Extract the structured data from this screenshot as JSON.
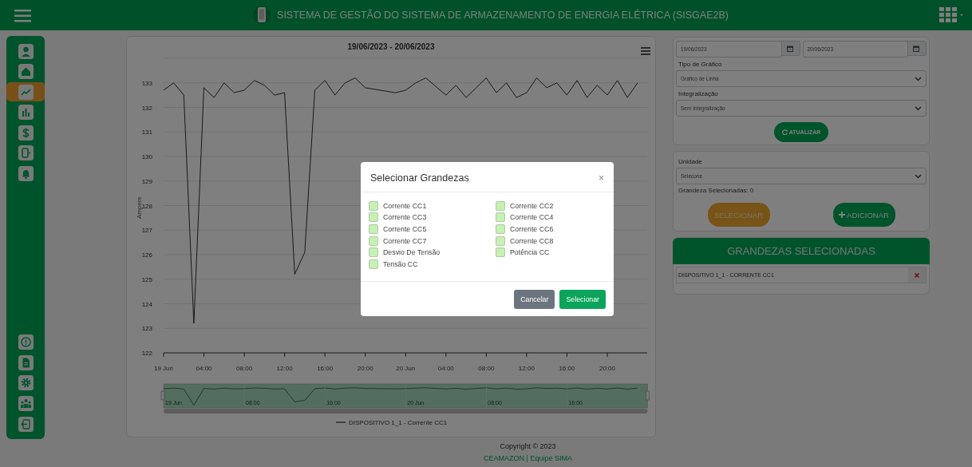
{
  "header": {
    "title": "SISTEMA DE GESTÃO DO SISTEMA DE ARMAZENAMENTO DE ENERGIA ELÉTRICA (SISGAE2B)"
  },
  "sidebar": {
    "top_items": [
      {
        "selected": false
      },
      {
        "selected": false
      },
      {
        "selected": true
      },
      {
        "selected": false
      },
      {
        "selected": false
      },
      {
        "selected": false
      },
      {
        "selected": false
      }
    ],
    "bottom_items": [
      {
        "selected": false
      },
      {
        "selected": false
      },
      {
        "selected": false
      },
      {
        "selected": false
      },
      {
        "selected": false
      }
    ]
  },
  "chart": {
    "navigator_labels": [
      "19 Jun",
      "08:00",
      "16:00",
      "20 Jun",
      "08:00",
      "16:00"
    ],
    "chart_data": {
      "type": "line",
      "title": "19/06/2023 - 20/06/2023",
      "ylabel": "Ampere",
      "x": [
        "2023-06-19T00:00",
        "2023-06-19T01:00",
        "2023-06-19T02:00",
        "2023-06-19T03:00",
        "2023-06-19T04:00",
        "2023-06-19T05:00",
        "2023-06-19T06:00",
        "2023-06-19T07:00",
        "2023-06-19T08:00",
        "2023-06-19T09:00",
        "2023-06-19T10:00",
        "2023-06-19T11:00",
        "2023-06-19T12:00",
        "2023-06-19T13:00",
        "2023-06-19T14:00",
        "2023-06-19T15:00",
        "2023-06-19T16:00",
        "2023-06-19T17:00",
        "2023-06-19T18:00",
        "2023-06-19T19:00",
        "2023-06-19T20:00",
        "2023-06-19T23:00",
        "2023-06-20T00:00",
        "2023-06-20T01:00",
        "2023-06-20T02:00",
        "2023-06-20T04:00",
        "2023-06-20T05:00",
        "2023-06-20T06:00",
        "2023-06-20T07:00",
        "2023-06-20T08:00",
        "2023-06-20T09:00",
        "2023-06-20T10:00",
        "2023-06-20T11:00",
        "2023-06-20T12:00",
        "2023-06-20T13:00",
        "2023-06-20T14:00",
        "2023-06-20T15:00",
        "2023-06-20T16:00",
        "2023-06-20T17:00",
        "2023-06-20T18:00",
        "2023-06-20T19:00",
        "2023-06-20T20:00",
        "2023-06-20T21:00",
        "2023-06-20T22:00",
        "2023-06-20T23:00"
      ],
      "series": [
        {
          "name": "DISPOSITIVO 1_1 - Corrente CC1",
          "color": "#333333",
          "values": [
            132.7,
            133.0,
            132.5,
            123.2,
            132.8,
            132.4,
            133.0,
            132.6,
            132.7,
            133.1,
            132.9,
            132.5,
            132.6,
            125.2,
            126.1,
            132.7,
            133.1,
            132.5,
            133.0,
            133.2,
            132.8,
            132.6,
            132.7,
            133.0,
            133.2,
            132.5,
            132.9,
            132.4,
            132.8,
            133.2,
            132.6,
            133.0,
            132.4,
            132.6,
            133.2,
            132.8,
            133.0,
            132.5,
            133.1,
            132.4,
            132.9,
            132.5,
            133.1,
            132.4,
            133.0
          ]
        }
      ],
      "xlim": [
        "2023-06-19T00:00",
        "2023-06-21T00:00"
      ],
      "ylim": [
        122,
        134
      ],
      "grid": true,
      "xticks": [
        {
          "value": "2023-06-19T00:00",
          "label": "19 Jun"
        },
        {
          "value": "2023-06-19T04:00",
          "label": "04:00"
        },
        {
          "value": "2023-06-19T08:00",
          "label": "08:00"
        },
        {
          "value": "2023-06-19T12:00",
          "label": "12:00"
        },
        {
          "value": "2023-06-19T16:00",
          "label": "16:00"
        },
        {
          "value": "2023-06-19T20:00",
          "label": "20:00"
        },
        {
          "value": "2023-06-20T00:00",
          "label": "20 Jun"
        },
        {
          "value": "2023-06-20T04:00",
          "label": "04:00"
        },
        {
          "value": "2023-06-20T08:00",
          "label": "08:00"
        },
        {
          "value": "2023-06-20T12:00",
          "label": "12:00"
        },
        {
          "value": "2023-06-20T16:00",
          "label": "16:00"
        },
        {
          "value": "2023-06-20T20:00",
          "label": "20:00"
        }
      ],
      "yticks": [
        122,
        123,
        124,
        125,
        126,
        127,
        128,
        129,
        130,
        131,
        132,
        133
      ]
    }
  },
  "filters": {
    "start_date": "19/06/2023",
    "end_date": "20/06/2023",
    "fields": [
      {
        "label": "Tipo de Gráfico",
        "value": "Gráfico de Linha"
      },
      {
        "label": "Integralização",
        "value": "Sem Integralização"
      }
    ],
    "button": "ATUALIZAR"
  },
  "unit": {
    "label": "Unidade",
    "value": "Selecone",
    "count": "Grandeza Selecionadas: 0",
    "buttons": [
      {
        "label": "SELECIONAR",
        "kind": "select"
      },
      {
        "label": "ADICIONAR",
        "kind": "add"
      }
    ]
  },
  "selected_panel": {
    "title": "GRANDEZAS SELECIONADAS",
    "items": [
      "DISPOSITIVO 1_1 - CORRENTE CC1"
    ]
  },
  "footer": {
    "copyright": "Copyright © 2023",
    "link": "CEAMAZON | Equipe SIMA"
  },
  "modal": {
    "title": "Selecionar Grandezas",
    "close": "×",
    "options": [
      {
        "label": "Corrente CC1",
        "checked": false
      },
      {
        "label": "Corrente CC2",
        "checked": false
      },
      {
        "label": "Corrente CC3",
        "checked": false
      },
      {
        "label": "Corrente CC4",
        "checked": false
      },
      {
        "label": "Corrente CC5",
        "checked": false
      },
      {
        "label": "Corrente CC6",
        "checked": false
      },
      {
        "label": "Corrente CC7",
        "checked": false
      },
      {
        "label": "Corrente CC8",
        "checked": false
      },
      {
        "label": "Desvio De Tensão",
        "checked": false
      },
      {
        "label": "Potência CC",
        "checked": false
      },
      {
        "label": "Tensão CC",
        "checked": false
      }
    ],
    "buttons": [
      {
        "label": "Cancelar",
        "kind": "secondary"
      },
      {
        "label": "Selecionar",
        "kind": "primary"
      }
    ]
  }
}
